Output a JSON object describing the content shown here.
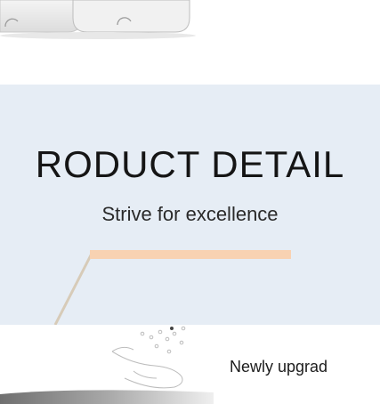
{
  "banner": {
    "title": "RODUCT DETAIL",
    "subtitle": "Strive for excellence",
    "accent_color": "#f8d2b2",
    "background_color": "#e6edf5"
  },
  "feature": {
    "text": "Newly upgrad",
    "icon": "hand-sensor-icon"
  },
  "top_product": {
    "icon": "product-device-bottom"
  }
}
